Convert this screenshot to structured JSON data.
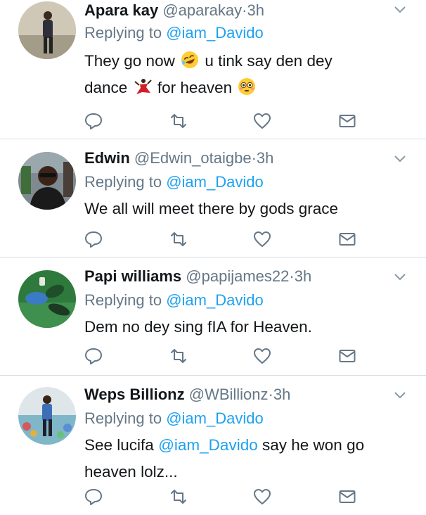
{
  "colors": {
    "accent": "#1da1f2",
    "muted": "#657786",
    "text": "#14171a",
    "divider": "#d8dde2"
  },
  "tweets": [
    {
      "name": "Apara kay",
      "handle": "@aparakay",
      "dot": "·",
      "time": "3h",
      "replying_prefix": "Replying to",
      "replying_to": "@iam_Davido",
      "line1_a": "They go now",
      "line1_b": "u tink say den dey",
      "line2_a": "dance",
      "line2_b": "for heaven",
      "emojis": [
        "rolling-laughing-emoji",
        "dancer-emoji",
        "flushed-emoji"
      ]
    },
    {
      "name": "Edwin",
      "handle": "@Edwin_otaigbe",
      "dot": "·",
      "time": "3h",
      "replying_prefix": "Replying to",
      "replying_to": "@iam_Davido",
      "text": "We all will meet there by gods grace"
    },
    {
      "name": "Papi williams",
      "handle": "@papijames22",
      "dot": "·",
      "time": "3h",
      "replying_prefix": "Replying to",
      "replying_to": "@iam_Davido",
      "text": "Dem no dey sing fIA for Heaven."
    },
    {
      "name": "Weps Billionz",
      "handle": "@WBillionz",
      "dot": "·",
      "time": "3h",
      "replying_prefix": "Replying to",
      "replying_to": "@iam_Davido",
      "text_a": "See lucifa",
      "text_mention": "@iam_Davido",
      "text_b": "say he won go",
      "text_line2": "heaven lolz..."
    }
  ],
  "action_icons": [
    "reply-icon",
    "retweet-icon",
    "like-icon",
    "dm-icon"
  ]
}
